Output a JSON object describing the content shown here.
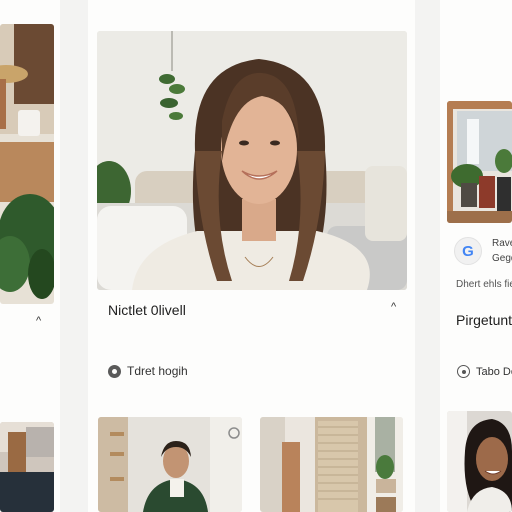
{
  "main_card": {
    "title": "Nictlet 0livell",
    "meta_label": "Tdret hogih"
  },
  "right_card": {
    "title": "Pirgetunt",
    "source_line1": "Rave",
    "source_line2": "Gegd",
    "caption": "Dhert ehls fie",
    "meta_label": "Tabo De",
    "badge_letter": "G"
  },
  "left_card": {
    "chevron": "^"
  },
  "icons": {
    "chevron": "chevron-up-icon",
    "google": "google-icon",
    "meta_main": "tag-icon",
    "meta_right": "tag-icon"
  },
  "colors": {
    "background": "#f3f3f2",
    "card": "#fdfdfc",
    "google_blue": "#4285f4",
    "google_red": "#ea4335",
    "google_yellow": "#fbbc05",
    "google_green": "#34a853"
  }
}
